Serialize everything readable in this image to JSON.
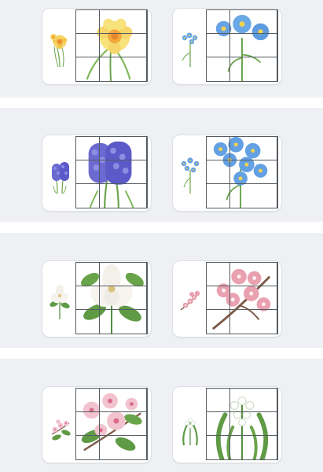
{
  "colors": {
    "page_background": "#ffffff",
    "band_background": "#eef0f3",
    "card_background": "#ffffff",
    "grid_lines": "#555b61"
  },
  "puzzles": [
    {
      "name": "daffodil",
      "thumb_icon": "daffodil-icon",
      "grid": {
        "rows": 3,
        "cols": 3
      }
    },
    {
      "name": "forget-me-not",
      "thumb_icon": "forget-me-not-icon",
      "grid": {
        "rows": 3,
        "cols": 3
      }
    },
    {
      "name": "hyacinth",
      "thumb_icon": "hyacinth-icon",
      "grid": {
        "rows": 3,
        "cols": 3
      }
    },
    {
      "name": "forget-me-not-cluster",
      "thumb_icon": "forget-me-not-cluster-icon",
      "grid": {
        "rows": 3,
        "cols": 3
      }
    },
    {
      "name": "magnolia",
      "thumb_icon": "magnolia-icon",
      "grid": {
        "rows": 3,
        "cols": 3
      }
    },
    {
      "name": "cherry-blossom",
      "thumb_icon": "cherry-blossom-icon",
      "grid": {
        "rows": 3,
        "cols": 3
      }
    },
    {
      "name": "apple-blossom",
      "thumb_icon": "apple-blossom-icon",
      "grid": {
        "rows": 3,
        "cols": 3
      }
    },
    {
      "name": "lily-of-the-valley",
      "thumb_icon": "lily-of-the-valley-icon",
      "grid": {
        "rows": 3,
        "cols": 3
      }
    }
  ]
}
